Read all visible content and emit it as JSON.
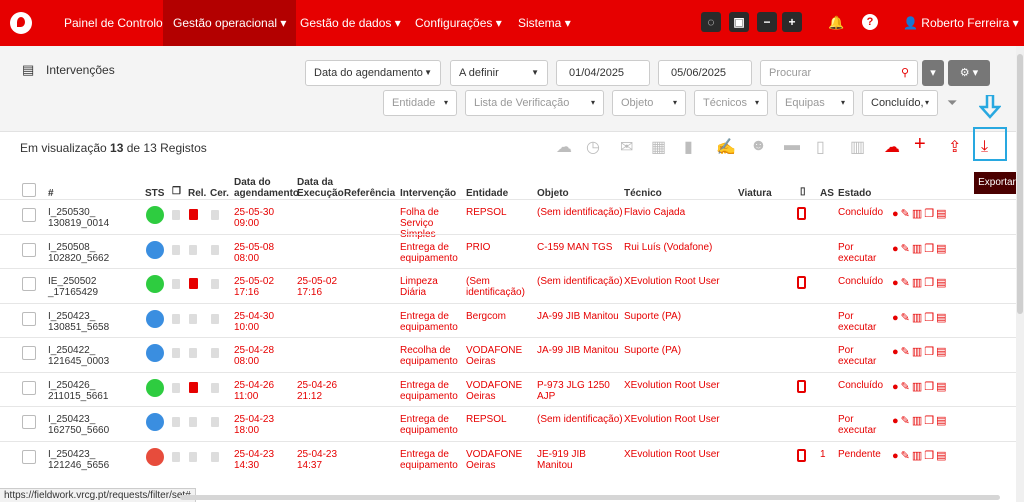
{
  "nav": {
    "items": [
      "Painel de Controlo",
      "Gestão operacional",
      "Gestão de dados",
      "Configurações",
      "Sistema"
    ],
    "user": "Roberto Ferreira",
    "minus": "−",
    "plus": "+",
    "help": "?"
  },
  "panel": {
    "title": "Intervenções",
    "date_type": "Data do agendamento",
    "state": "A definir",
    "date_from": "01/04/2025",
    "date_to": "05/06/2025",
    "search_placeholder": "Procurar",
    "filters": [
      "Entidade",
      "Lista de Verificação",
      "Objeto",
      "Técnicos",
      "Equipas"
    ],
    "filter_selected": "Concluído,"
  },
  "records": {
    "prefix": "Em visualização",
    "shown": "13",
    "mid": "de 13 Registos"
  },
  "tooltip": "Exportar",
  "status_url": "https://fieldwork.vrcg.pt/requests/filter/set#",
  "headers": {
    "num": "#",
    "sts": "STS",
    "rel": "Rel.",
    "cer": "Cer.",
    "ag": "Data do agendamento",
    "ag1": "Data do",
    "ag2": "agendamento",
    "ex1": "Data da",
    "ex2": "Execução",
    "ref": "Referência",
    "int": "Intervenção",
    "ent": "Entidade",
    "obj": "Objeto",
    "tec": "Técnico",
    "via": "Viatura",
    "as": "AS",
    "est": "Estado"
  },
  "rows": [
    {
      "id1": "I_250530_",
      "id2": "130819_0014",
      "dot": "#2ecc40",
      "ag1": "25-05-30",
      "ag2": "09:00",
      "ex1": "",
      "ex2": "",
      "int": "Folha de Serviço Simples",
      "ent": "REPSOL",
      "obj": "(Sem identificação)",
      "tec": "Flavio Cajada",
      "phone": true,
      "as": "",
      "est": "Concluído",
      "rel": true
    },
    {
      "id1": "I_250508_",
      "id2": "102820_5662",
      "dot": "#3a8ee0",
      "ag1": "25-05-08",
      "ag2": "08:00",
      "ex1": "",
      "ex2": "",
      "int": "Entrega de equipamento",
      "ent": "PRIO",
      "obj": "C-159 MAN TGS",
      "tec": "Rui Luís (Vodafone)",
      "phone": false,
      "as": "",
      "est": "Por executar",
      "rel": false
    },
    {
      "id1": "IE_250502",
      "id2": "_17165429",
      "dot": "#2ecc40",
      "ag1": "25-05-02",
      "ag2": "17:16",
      "ex1": "25-05-02",
      "ex2": "17:16",
      "int": "Limpeza Diária",
      "ent": "(Sem identificação)",
      "obj": "(Sem identificação)",
      "tec": "XEvolution Root User",
      "phone": true,
      "as": "",
      "est": "Concluído",
      "rel": true
    },
    {
      "id1": "I_250423_",
      "id2": "130851_5658",
      "dot": "#3a8ee0",
      "ag1": "25-04-30",
      "ag2": "10:00",
      "ex1": "",
      "ex2": "",
      "int": "Entrega de equipamento",
      "ent": "Bergcom",
      "obj": "JA-99 JIB Manitou",
      "tec": "Suporte (PA)",
      "phone": false,
      "as": "",
      "est": "Por executar",
      "rel": false
    },
    {
      "id1": "I_250422_",
      "id2": "121645_0003",
      "dot": "#3a8ee0",
      "ag1": "25-04-28",
      "ag2": "08:00",
      "ex1": "",
      "ex2": "",
      "int": "Recolha de equipamento",
      "ent": "VODAFONE Oeiras",
      "obj": "JA-99 JIB Manitou",
      "tec": "Suporte (PA)",
      "phone": false,
      "as": "",
      "est": "Por executar",
      "rel": false
    },
    {
      "id1": "I_250426_",
      "id2": "211015_5661",
      "dot": "#2ecc40",
      "ag1": "25-04-26",
      "ag2": "11:00",
      "ex1": "25-04-26",
      "ex2": "21:12",
      "int": "Entrega de equipamento",
      "ent": "VODAFONE Oeiras",
      "obj": "P-973 JLG 1250 AJP",
      "tec": "XEvolution Root User",
      "phone": true,
      "as": "",
      "est": "Concluído",
      "rel": true
    },
    {
      "id1": "I_250423_",
      "id2": "162750_5660",
      "dot": "#3a8ee0",
      "ag1": "25-04-23",
      "ag2": "18:00",
      "ex1": "",
      "ex2": "",
      "int": "Entrega de equipamento",
      "ent": "REPSOL",
      "obj": "(Sem identificação)",
      "tec": "XEvolution Root User",
      "phone": false,
      "as": "",
      "est": "Por executar",
      "rel": false
    },
    {
      "id1": "I_250423_",
      "id2": "121246_5656",
      "dot": "#e74c3c",
      "ag1": "25-04-23",
      "ag2": "14:30",
      "ex1": "25-04-23",
      "ex2": "14:37",
      "int": "Entrega de equipamento",
      "ent": "VODAFONE Oeiras",
      "obj": "JE-919 JIB Manitou",
      "tec": "XEvolution Root User",
      "phone": true,
      "as": "1",
      "est": "Pendente",
      "rel": false
    }
  ]
}
